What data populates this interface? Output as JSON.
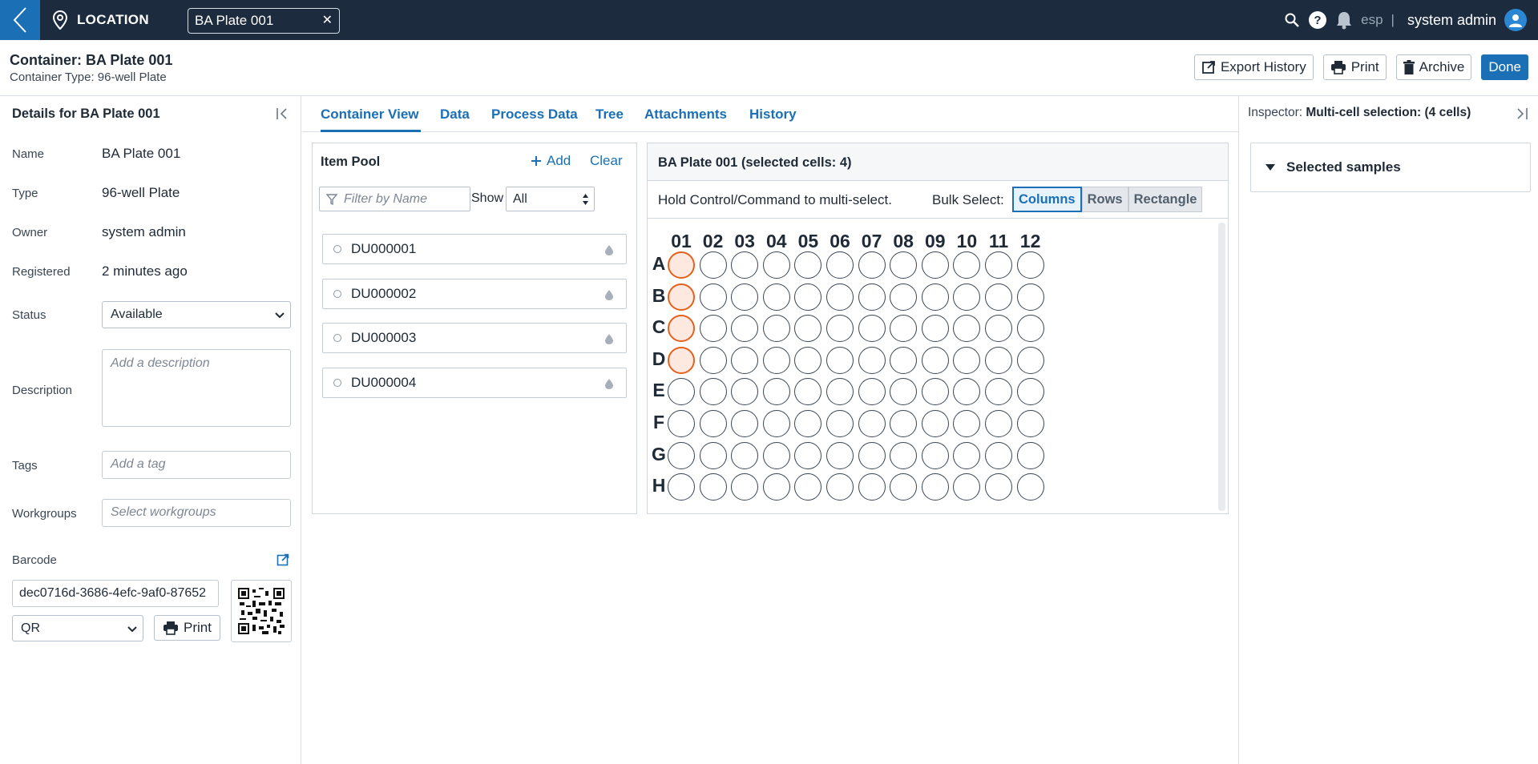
{
  "topbar": {
    "location_label": "LOCATION",
    "open_tab": "BA Plate 001",
    "workspace": "esp",
    "user_name": "system admin"
  },
  "header": {
    "title": "Container: BA Plate 001",
    "subtitle": "Container Type: 96-well Plate",
    "export_history": "Export History",
    "print": "Print",
    "archive": "Archive",
    "done": "Done"
  },
  "details": {
    "title": "Details for BA Plate 001",
    "name_label": "Name",
    "name_value": "BA Plate 001",
    "type_label": "Type",
    "type_value": "96-well Plate",
    "owner_label": "Owner",
    "owner_value": "system admin",
    "registered_label": "Registered",
    "registered_value": "2 minutes ago",
    "status_label": "Status",
    "status_value": "Available",
    "description_label": "Description",
    "description_placeholder": "Add a description",
    "tags_label": "Tags",
    "tags_placeholder": "Add a tag",
    "workgroups_label": "Workgroups",
    "workgroups_placeholder": "Select workgroups",
    "barcode_label": "Barcode",
    "barcode_value": "dec0716d-3686-4efc-9af0-87652",
    "barcode_type": "QR",
    "print_label": "Print"
  },
  "tabs": [
    "Container View",
    "Data",
    "Process Data",
    "Tree",
    "Attachments",
    "History"
  ],
  "item_pool": {
    "title": "Item Pool",
    "add": "Add",
    "clear": "Clear",
    "filter_placeholder": "Filter by Name",
    "show_label": "Show",
    "show_value": "All",
    "items": [
      "DU000001",
      "DU000002",
      "DU000003",
      "DU000004"
    ]
  },
  "plate": {
    "title": "BA Plate 001 (selected cells: 4)",
    "hint": "Hold Control/Command to multi-select.",
    "bulk_label": "Bulk Select:",
    "bulk_options": [
      "Columns",
      "Rows",
      "Rectangle"
    ],
    "bulk_active": "Columns",
    "columns": [
      "01",
      "02",
      "03",
      "04",
      "05",
      "06",
      "07",
      "08",
      "09",
      "10",
      "11",
      "12"
    ],
    "rows": [
      "A",
      "B",
      "C",
      "D",
      "E",
      "F",
      "G",
      "H"
    ],
    "selected_wells": [
      "A01",
      "B01",
      "C01",
      "D01"
    ],
    "selected_color": "#e4601d"
  },
  "inspector": {
    "prefix": "Inspector:",
    "selection": "Multi-cell selection: (4 cells)",
    "section": "Selected samples"
  },
  "colors": {
    "accent": "#1a6fb5",
    "topbar": "#1c2c3e"
  }
}
